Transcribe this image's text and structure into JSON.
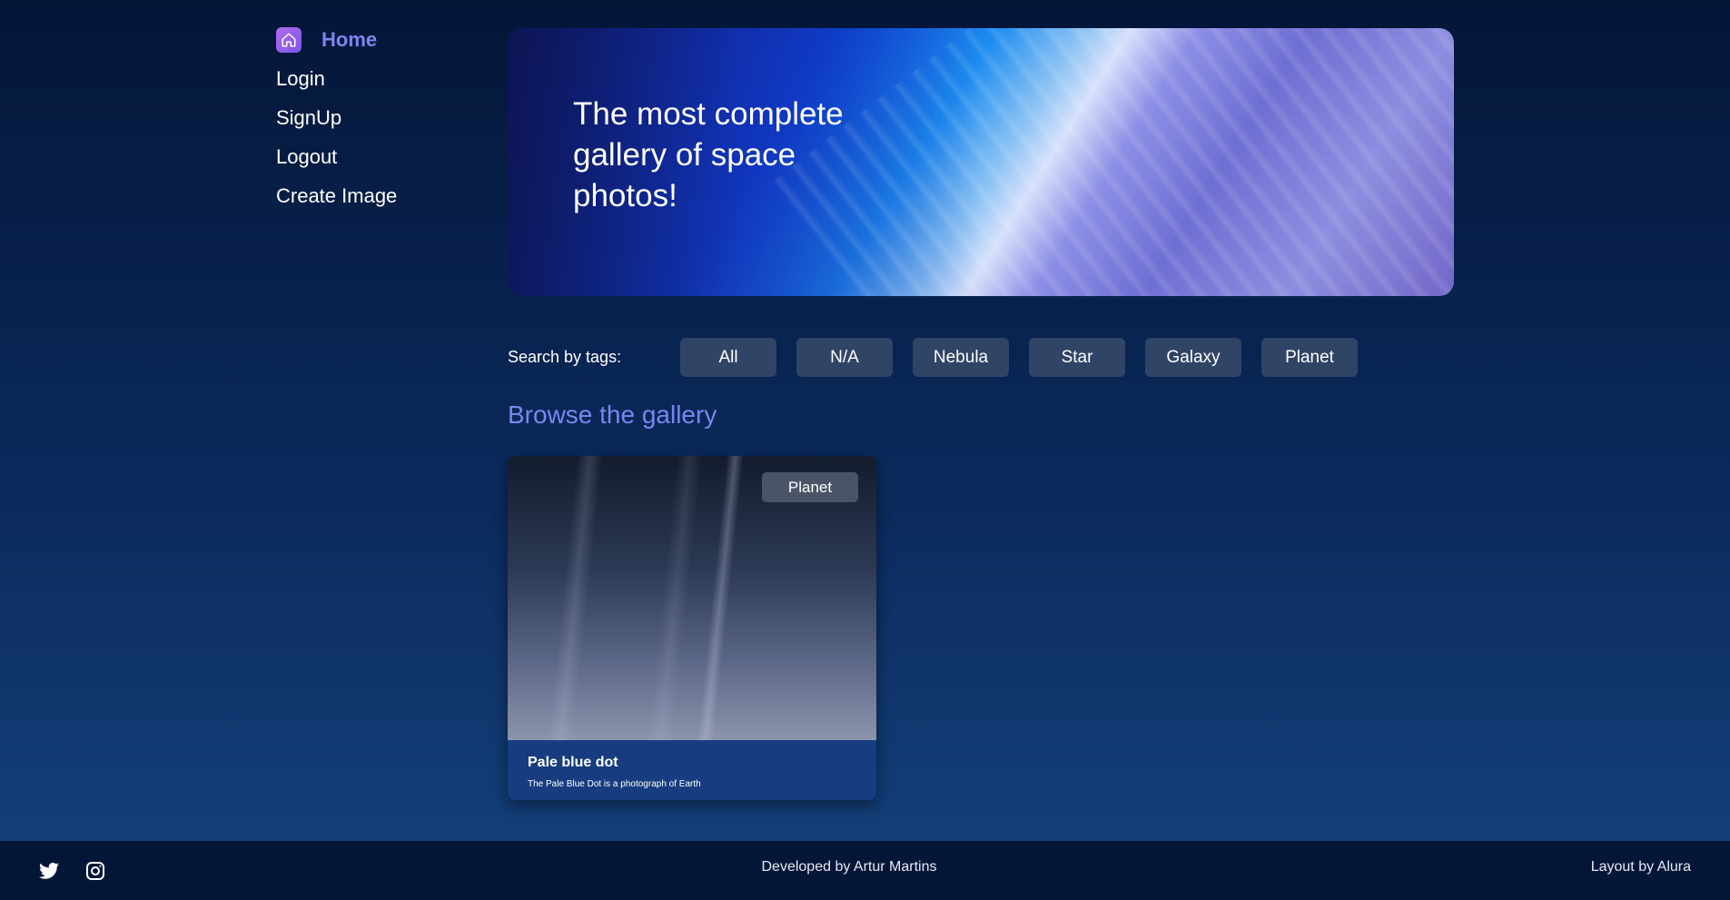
{
  "sidebar": {
    "items": [
      {
        "label": "Home",
        "icon": "home-icon",
        "active": true
      },
      {
        "label": "Login",
        "active": false
      },
      {
        "label": "SignUp",
        "active": false
      },
      {
        "label": "Logout",
        "active": false
      },
      {
        "label": "Create Image",
        "active": false
      }
    ]
  },
  "banner": {
    "title": "The most complete gallery of space photos!"
  },
  "tags": {
    "label": "Search by tags:",
    "buttons": [
      "All",
      "N/A",
      "Nebula",
      "Star",
      "Galaxy",
      "Planet"
    ]
  },
  "gallery": {
    "title": "Browse the gallery",
    "cards": [
      {
        "badge": "Planet",
        "title": "Pale blue dot",
        "description": "The Pale Blue Dot is a photograph of Earth"
      }
    ]
  },
  "footer": {
    "social": [
      "twitter-icon",
      "instagram-icon"
    ],
    "center_text": "Developed by Artur Martins",
    "right_text": "Layout by Alura"
  },
  "colors": {
    "accent": "#7b86ee",
    "tag_bg": "#304466",
    "footer_bg": "#041638",
    "card_bg": "#173d80"
  }
}
